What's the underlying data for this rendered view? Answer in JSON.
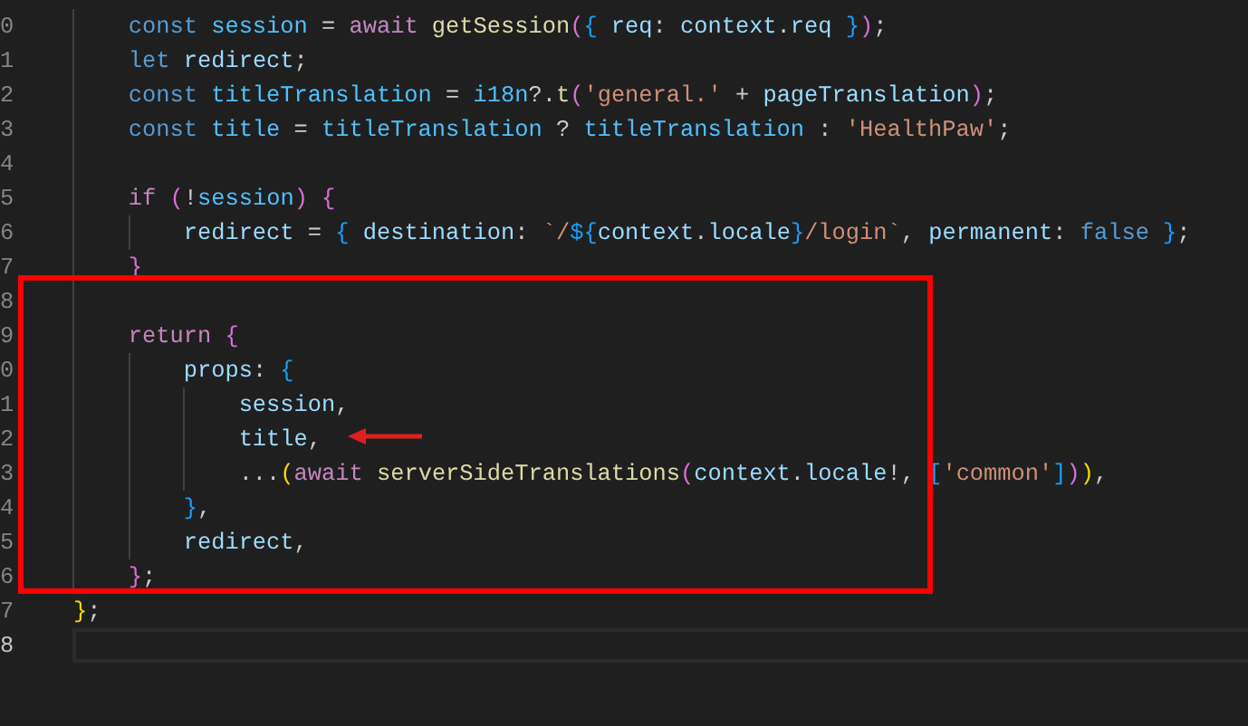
{
  "editor": {
    "lines": [
      {
        "number": "0",
        "current": false,
        "tokens": [
          {
            "text": "        const ",
            "kind": "kw"
          },
          {
            "text": "session",
            "kind": "cvar"
          },
          {
            "text": " = ",
            "kind": "p"
          },
          {
            "text": "await ",
            "kind": "ctl"
          },
          {
            "text": "getSession",
            "kind": "fn"
          },
          {
            "text": "(",
            "kind": "b2"
          },
          {
            "text": "{ ",
            "kind": "b3"
          },
          {
            "text": "req",
            "kind": "var"
          },
          {
            "text": ": ",
            "kind": "p"
          },
          {
            "text": "context",
            "kind": "var"
          },
          {
            "text": ".",
            "kind": "p"
          },
          {
            "text": "req ",
            "kind": "var"
          },
          {
            "text": "}",
            "kind": "b3"
          },
          {
            "text": ")",
            "kind": "b2"
          },
          {
            "text": ";",
            "kind": "p"
          }
        ]
      },
      {
        "number": "1",
        "current": false,
        "tokens": [
          {
            "text": "        let ",
            "kind": "kw"
          },
          {
            "text": "redirect",
            "kind": "var"
          },
          {
            "text": ";",
            "kind": "p"
          }
        ]
      },
      {
        "number": "2",
        "current": false,
        "tokens": [
          {
            "text": "        const ",
            "kind": "kw"
          },
          {
            "text": "titleTranslation",
            "kind": "cvar"
          },
          {
            "text": " = ",
            "kind": "p"
          },
          {
            "text": "i18n",
            "kind": "cvar"
          },
          {
            "text": "?.",
            "kind": "p"
          },
          {
            "text": "t",
            "kind": "fn"
          },
          {
            "text": "(",
            "kind": "b2"
          },
          {
            "text": "'general.'",
            "kind": "str"
          },
          {
            "text": " + ",
            "kind": "p"
          },
          {
            "text": "pageTranslation",
            "kind": "var"
          },
          {
            "text": ")",
            "kind": "b2"
          },
          {
            "text": ";",
            "kind": "p"
          }
        ]
      },
      {
        "number": "3",
        "current": false,
        "tokens": [
          {
            "text": "        const ",
            "kind": "kw"
          },
          {
            "text": "title",
            "kind": "cvar"
          },
          {
            "text": " = ",
            "kind": "p"
          },
          {
            "text": "titleTranslation",
            "kind": "cvar"
          },
          {
            "text": " ? ",
            "kind": "p"
          },
          {
            "text": "titleTranslation",
            "kind": "cvar"
          },
          {
            "text": " : ",
            "kind": "p"
          },
          {
            "text": "'HealthPaw'",
            "kind": "str"
          },
          {
            "text": ";",
            "kind": "p"
          }
        ]
      },
      {
        "number": "4",
        "current": false
      },
      {
        "number": "5",
        "current": false,
        "tokens": [
          {
            "text": "        if ",
            "kind": "ctl"
          },
          {
            "text": "(",
            "kind": "b2"
          },
          {
            "text": "!",
            "kind": "p"
          },
          {
            "text": "session",
            "kind": "cvar"
          },
          {
            "text": ") ",
            "kind": "b2"
          },
          {
            "text": "{",
            "kind": "b2"
          }
        ]
      },
      {
        "number": "6",
        "current": false,
        "tokens": [
          {
            "text": "            redirect",
            "kind": "var"
          },
          {
            "text": " = ",
            "kind": "p"
          },
          {
            "text": "{ ",
            "kind": "b3"
          },
          {
            "text": "destination",
            "kind": "var"
          },
          {
            "text": ": ",
            "kind": "p"
          },
          {
            "text": "`/",
            "kind": "str"
          },
          {
            "text": "${",
            "kind": "b3"
          },
          {
            "text": "context",
            "kind": "var"
          },
          {
            "text": ".",
            "kind": "p"
          },
          {
            "text": "locale",
            "kind": "var"
          },
          {
            "text": "}",
            "kind": "b3"
          },
          {
            "text": "/login`",
            "kind": "str"
          },
          {
            "text": ", ",
            "kind": "p"
          },
          {
            "text": "permanent",
            "kind": "var"
          },
          {
            "text": ": ",
            "kind": "p"
          },
          {
            "text": "false ",
            "kind": "kw"
          },
          {
            "text": "}",
            "kind": "b3"
          },
          {
            "text": ";",
            "kind": "p"
          }
        ]
      },
      {
        "number": "7",
        "current": false,
        "tokens": [
          {
            "text": "        }",
            "kind": "b2"
          }
        ]
      },
      {
        "number": "8",
        "current": false
      },
      {
        "number": "9",
        "current": false,
        "tokens": [
          {
            "text": "        return ",
            "kind": "ctl"
          },
          {
            "text": "{",
            "kind": "b2"
          }
        ]
      },
      {
        "number": "0",
        "current": false,
        "tokens": [
          {
            "text": "            props",
            "kind": "var"
          },
          {
            "text": ": ",
            "kind": "p"
          },
          {
            "text": "{",
            "kind": "b3"
          }
        ]
      },
      {
        "number": "1",
        "current": false,
        "tokens": [
          {
            "text": "                session",
            "kind": "var"
          },
          {
            "text": ",",
            "kind": "p"
          }
        ]
      },
      {
        "number": "2",
        "current": false,
        "tokens": [
          {
            "text": "                title",
            "kind": "var"
          },
          {
            "text": ",",
            "kind": "p"
          }
        ]
      },
      {
        "number": "3",
        "current": false,
        "tokens": [
          {
            "text": "                ...",
            "kind": "p"
          },
          {
            "text": "(",
            "kind": "b1"
          },
          {
            "text": "await ",
            "kind": "ctl"
          },
          {
            "text": "serverSideTranslations",
            "kind": "fn"
          },
          {
            "text": "(",
            "kind": "b2"
          },
          {
            "text": "context",
            "kind": "var"
          },
          {
            "text": ".",
            "kind": "p"
          },
          {
            "text": "locale",
            "kind": "var"
          },
          {
            "text": "!, ",
            "kind": "p"
          },
          {
            "text": "[",
            "kind": "b3"
          },
          {
            "text": "'common'",
            "kind": "str"
          },
          {
            "text": "]",
            "kind": "b3"
          },
          {
            "text": ")",
            "kind": "b2"
          },
          {
            "text": ")",
            "kind": "b1"
          },
          {
            "text": ",",
            "kind": "p"
          }
        ]
      },
      {
        "number": "4",
        "current": false,
        "tokens": [
          {
            "text": "            }",
            "kind": "b3"
          },
          {
            "text": ",",
            "kind": "p"
          }
        ]
      },
      {
        "number": "5",
        "current": false,
        "tokens": [
          {
            "text": "            redirect",
            "kind": "var"
          },
          {
            "text": ",",
            "kind": "p"
          }
        ]
      },
      {
        "number": "6",
        "current": false,
        "tokens": [
          {
            "text": "        }",
            "kind": "b2"
          },
          {
            "text": ";",
            "kind": "p"
          }
        ]
      },
      {
        "number": "7",
        "current": false,
        "tokens": [
          {
            "text": "    }",
            "kind": "b1"
          },
          {
            "text": ";",
            "kind": "p"
          }
        ]
      },
      {
        "number": "8",
        "current": true
      }
    ]
  }
}
